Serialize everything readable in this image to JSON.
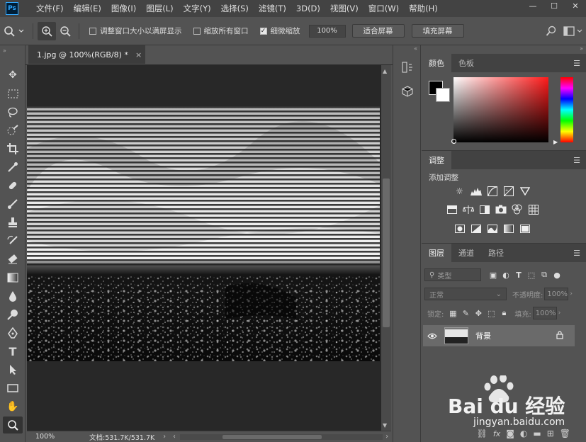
{
  "menubar": {
    "logo": "Ps",
    "items": [
      "文件(F)",
      "编辑(E)",
      "图像(I)",
      "图层(L)",
      "文字(Y)",
      "选择(S)",
      "滤镜(T)",
      "3D(D)",
      "视图(V)",
      "窗口(W)",
      "帮助(H)"
    ],
    "window_controls": [
      "—",
      "☐",
      "✕"
    ]
  },
  "options_bar": {
    "resize_windows_label": "调整窗口大小以满屏显示",
    "resize_windows_checked": false,
    "zoom_all_label": "缩放所有窗口",
    "zoom_all_checked": false,
    "scrubby_zoom_label": "细微缩放",
    "scrubby_zoom_checked": true,
    "zoom_value": "100%",
    "fit_screen_label": "适合屏幕",
    "fill_screen_label": "填充屏幕"
  },
  "document": {
    "tab_title": "1.jpg @ 100%(RGB/8) *",
    "tab_close": "×",
    "zoom": "100%",
    "doc_info": "文档:531.7K/531.7K"
  },
  "color_panel": {
    "tabs": [
      "颜色",
      "色板"
    ],
    "foreground": "#000000",
    "background": "#ffffff"
  },
  "adjustments_panel": {
    "tab": "调整",
    "subtitle": "添加调整"
  },
  "layers_panel": {
    "tabs": [
      "图层",
      "通道",
      "路径"
    ],
    "filter_kind": "类型",
    "blend_mode": "正常",
    "opacity_label": "不透明度:",
    "opacity_value": "100%",
    "lock_label": "锁定:",
    "fill_label": "填充:",
    "fill_value": "100%",
    "layers": [
      {
        "name": "背景",
        "visible": true,
        "locked": true
      }
    ],
    "footer_fx": "fx"
  },
  "watermark": {
    "brand": "Bai du 经验",
    "url": "jingyan.baidu.com"
  },
  "colors": {
    "accent": "#31a8ff",
    "menubar": "#434343",
    "panel": "#535353",
    "canvas": "#282828"
  }
}
